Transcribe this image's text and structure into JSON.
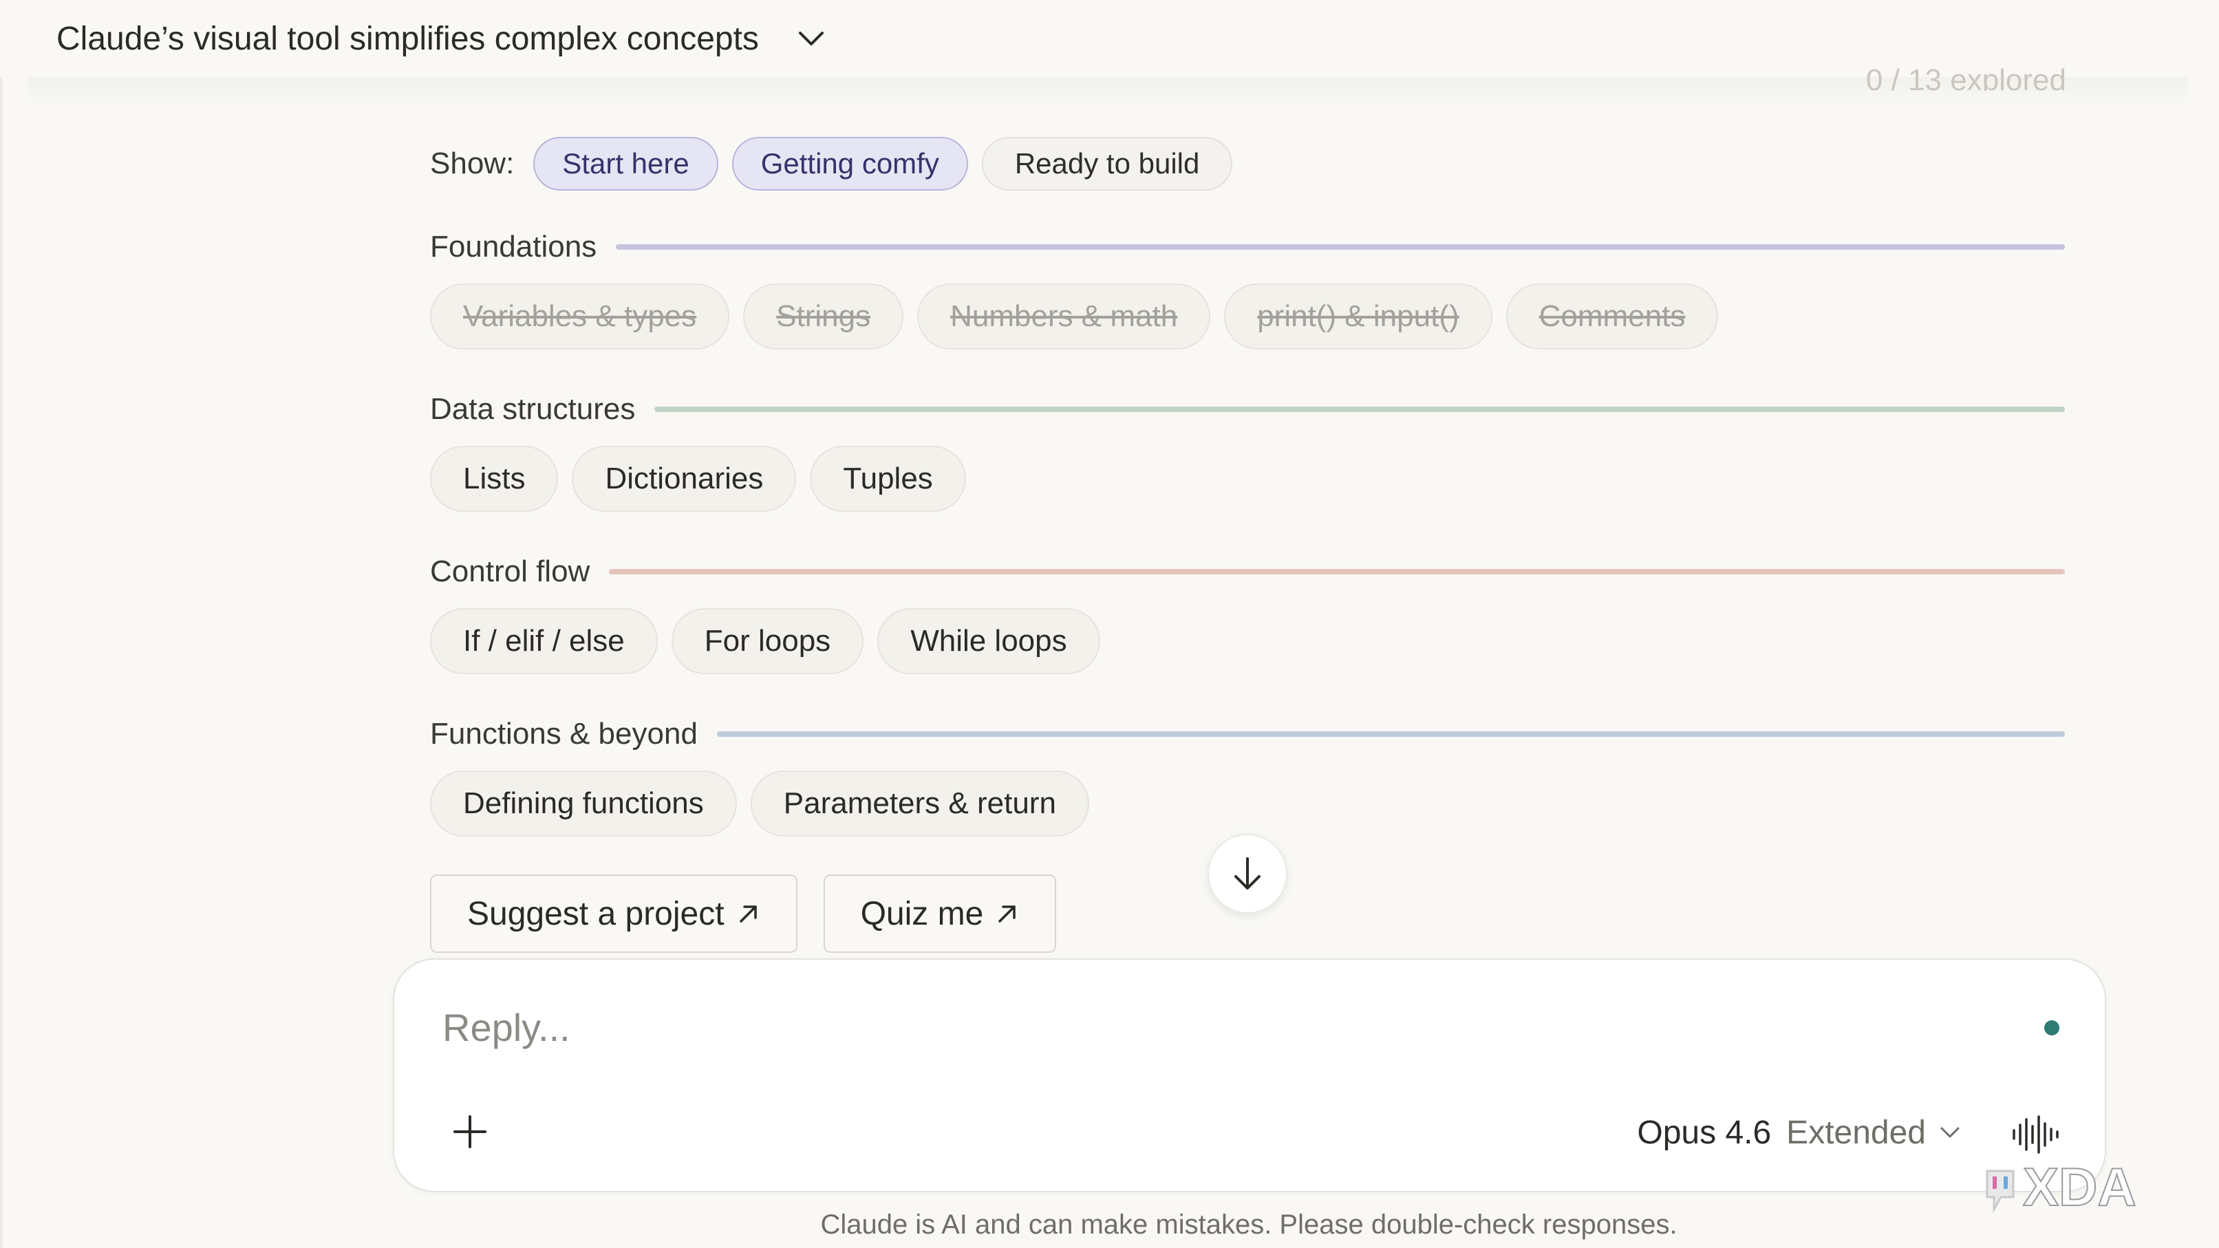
{
  "header": {
    "title": "Claude’s visual tool simplifies complex concepts",
    "chevron_icon": "chevron-down-icon"
  },
  "progress": {
    "faded_text": "0 / 13 explored"
  },
  "filter": {
    "label": "Show:",
    "chips": [
      {
        "label": "Start here",
        "active": true
      },
      {
        "label": "Getting comfy",
        "active": true
      },
      {
        "label": "Ready to build",
        "active": false
      }
    ]
  },
  "sections": [
    {
      "title": "Foundations",
      "color": "#c6c3df",
      "items": [
        {
          "label": "Variables & types",
          "done": true
        },
        {
          "label": "Strings",
          "done": true
        },
        {
          "label": "Numbers & math",
          "done": true
        },
        {
          "label": "print() & input()",
          "done": true
        },
        {
          "label": "Comments",
          "done": true
        }
      ]
    },
    {
      "title": "Data structures",
      "color": "#c2d3c6",
      "items": [
        {
          "label": "Lists",
          "done": false
        },
        {
          "label": "Dictionaries",
          "done": false
        },
        {
          "label": "Tuples",
          "done": false
        }
      ]
    },
    {
      "title": "Control flow",
      "color": "#e3c5bd",
      "items": [
        {
          "label": "If / elif / else",
          "done": false
        },
        {
          "label": "For loops",
          "done": false
        },
        {
          "label": "While loops",
          "done": false
        }
      ]
    },
    {
      "title": "Functions & beyond",
      "color": "#bfcbdb",
      "items": [
        {
          "label": "Defining functions",
          "done": false
        },
        {
          "label": "Parameters & return",
          "done": false
        }
      ]
    }
  ],
  "actions": {
    "suggest_label": "Suggest a project",
    "quiz_label": "Quiz me",
    "arrow_icon": "arrow-up-right-icon"
  },
  "scroll_icon": "arrow-down-icon",
  "composer": {
    "placeholder": "Reply...",
    "model": "Opus 4.6",
    "mode": "Extended",
    "plus_icon": "plus-icon",
    "voice_icon": "voice-waveform-icon",
    "status_color": "#2f7b72"
  },
  "disclaimer": "Claude is AI and can make mistakes. Please double-check responses.",
  "watermark": "XDA"
}
